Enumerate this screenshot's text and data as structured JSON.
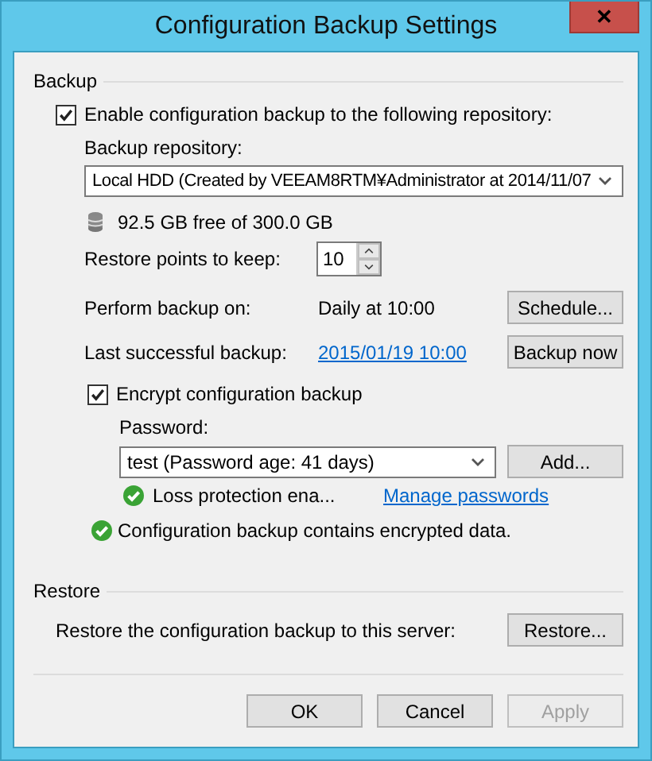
{
  "window": {
    "title": "Configuration Backup Settings",
    "close": "✕"
  },
  "backup": {
    "header": "Backup",
    "enable": {
      "label": "Enable configuration backup to the following repository:",
      "checked": true
    },
    "repository_label": "Backup repository:",
    "repository": {
      "value": "Local HDD (Created by VEEAM8RTM¥Administrator at 2014/11/07"
    },
    "free_space": "92.5 GB free of 300.0 GB",
    "restore_points": {
      "label": "Restore points to keep:",
      "value": "10"
    },
    "perform": {
      "label": "Perform backup on:",
      "value": "Daily at 10:00",
      "button": "Schedule..."
    },
    "last": {
      "label": "Last successful backup:",
      "link": "2015/01/19 10:00",
      "button": "Backup now"
    },
    "encrypt": {
      "label": "Encrypt configuration backup",
      "checked": true
    },
    "password_label": "Password:",
    "password": {
      "value": "test (Password age: 41 days)"
    },
    "add_button": "Add...",
    "loss_protection": "Loss protection ena...",
    "manage_link": "Manage passwords",
    "status": "Configuration backup contains encrypted data."
  },
  "restore": {
    "header": "Restore",
    "label": "Restore the configuration backup to this server:",
    "button": "Restore..."
  },
  "buttons": [
    {
      "label": "OK",
      "disabled": false
    },
    {
      "label": "Cancel",
      "disabled": false
    },
    {
      "label": "Apply",
      "disabled": true
    }
  ]
}
